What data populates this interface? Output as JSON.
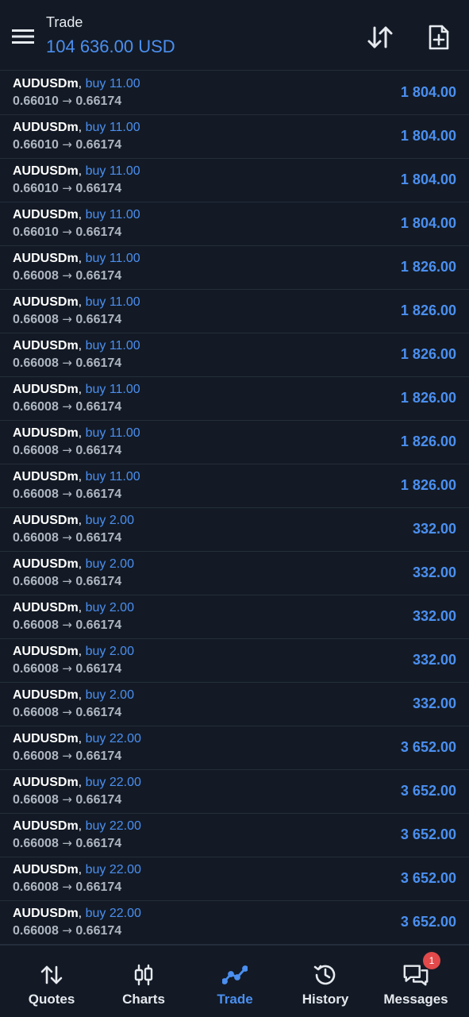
{
  "header": {
    "title": "Trade",
    "balance": "104 636.00 USD"
  },
  "positions": [
    {
      "symbol": "AUDUSDm",
      "separator": ",",
      "direction": "buy 11.00",
      "open": "0.66010",
      "arrow": "→",
      "current": "0.66174",
      "profit": "1 804.00"
    },
    {
      "symbol": "AUDUSDm",
      "separator": ",",
      "direction": "buy 11.00",
      "open": "0.66010",
      "arrow": "→",
      "current": "0.66174",
      "profit": "1 804.00"
    },
    {
      "symbol": "AUDUSDm",
      "separator": ",",
      "direction": "buy 11.00",
      "open": "0.66010",
      "arrow": "→",
      "current": "0.66174",
      "profit": "1 804.00"
    },
    {
      "symbol": "AUDUSDm",
      "separator": ",",
      "direction": "buy 11.00",
      "open": "0.66010",
      "arrow": "→",
      "current": "0.66174",
      "profit": "1 804.00"
    },
    {
      "symbol": "AUDUSDm",
      "separator": ",",
      "direction": "buy 11.00",
      "open": "0.66008",
      "arrow": "→",
      "current": "0.66174",
      "profit": "1 826.00"
    },
    {
      "symbol": "AUDUSDm",
      "separator": ",",
      "direction": "buy 11.00",
      "open": "0.66008",
      "arrow": "→",
      "current": "0.66174",
      "profit": "1 826.00"
    },
    {
      "symbol": "AUDUSDm",
      "separator": ",",
      "direction": "buy 11.00",
      "open": "0.66008",
      "arrow": "→",
      "current": "0.66174",
      "profit": "1 826.00"
    },
    {
      "symbol": "AUDUSDm",
      "separator": ",",
      "direction": "buy 11.00",
      "open": "0.66008",
      "arrow": "→",
      "current": "0.66174",
      "profit": "1 826.00"
    },
    {
      "symbol": "AUDUSDm",
      "separator": ",",
      "direction": "buy 11.00",
      "open": "0.66008",
      "arrow": "→",
      "current": "0.66174",
      "profit": "1 826.00"
    },
    {
      "symbol": "AUDUSDm",
      "separator": ",",
      "direction": "buy 11.00",
      "open": "0.66008",
      "arrow": "→",
      "current": "0.66174",
      "profit": "1 826.00"
    },
    {
      "symbol": "AUDUSDm",
      "separator": ",",
      "direction": "buy 2.00",
      "open": "0.66008",
      "arrow": "→",
      "current": "0.66174",
      "profit": "332.00"
    },
    {
      "symbol": "AUDUSDm",
      "separator": ",",
      "direction": "buy 2.00",
      "open": "0.66008",
      "arrow": "→",
      "current": "0.66174",
      "profit": "332.00"
    },
    {
      "symbol": "AUDUSDm",
      "separator": ",",
      "direction": "buy 2.00",
      "open": "0.66008",
      "arrow": "→",
      "current": "0.66174",
      "profit": "332.00"
    },
    {
      "symbol": "AUDUSDm",
      "separator": ",",
      "direction": "buy 2.00",
      "open": "0.66008",
      "arrow": "→",
      "current": "0.66174",
      "profit": "332.00"
    },
    {
      "symbol": "AUDUSDm",
      "separator": ",",
      "direction": "buy 2.00",
      "open": "0.66008",
      "arrow": "→",
      "current": "0.66174",
      "profit": "332.00"
    },
    {
      "symbol": "AUDUSDm",
      "separator": ",",
      "direction": "buy 22.00",
      "open": "0.66008",
      "arrow": "→",
      "current": "0.66174",
      "profit": "3 652.00"
    },
    {
      "symbol": "AUDUSDm",
      "separator": ",",
      "direction": "buy 22.00",
      "open": "0.66008",
      "arrow": "→",
      "current": "0.66174",
      "profit": "3 652.00"
    },
    {
      "symbol": "AUDUSDm",
      "separator": ",",
      "direction": "buy 22.00",
      "open": "0.66008",
      "arrow": "→",
      "current": "0.66174",
      "profit": "3 652.00"
    },
    {
      "symbol": "AUDUSDm",
      "separator": ",",
      "direction": "buy 22.00",
      "open": "0.66008",
      "arrow": "→",
      "current": "0.66174",
      "profit": "3 652.00"
    },
    {
      "symbol": "AUDUSDm",
      "separator": ",",
      "direction": "buy 22.00",
      "open": "0.66008",
      "arrow": "→",
      "current": "0.66174",
      "profit": "3 652.00"
    }
  ],
  "nav": {
    "quotes": "Quotes",
    "charts": "Charts",
    "trade": "Trade",
    "history": "History",
    "messages": "Messages",
    "messages_badge": "1"
  },
  "icons": {
    "menu": "hamburger-menu-icon",
    "sort": "sort-arrows-icon",
    "new_order": "new-document-plus-icon",
    "quotes": "up-down-arrows-icon",
    "charts": "candlestick-icon",
    "trade": "trend-line-icon",
    "history": "clock-history-icon",
    "messages": "chat-bubbles-icon"
  },
  "colors": {
    "background": "#131a25",
    "accent": "#4b8ff0",
    "badge": "#e2494a",
    "divider": "#242d3b"
  }
}
